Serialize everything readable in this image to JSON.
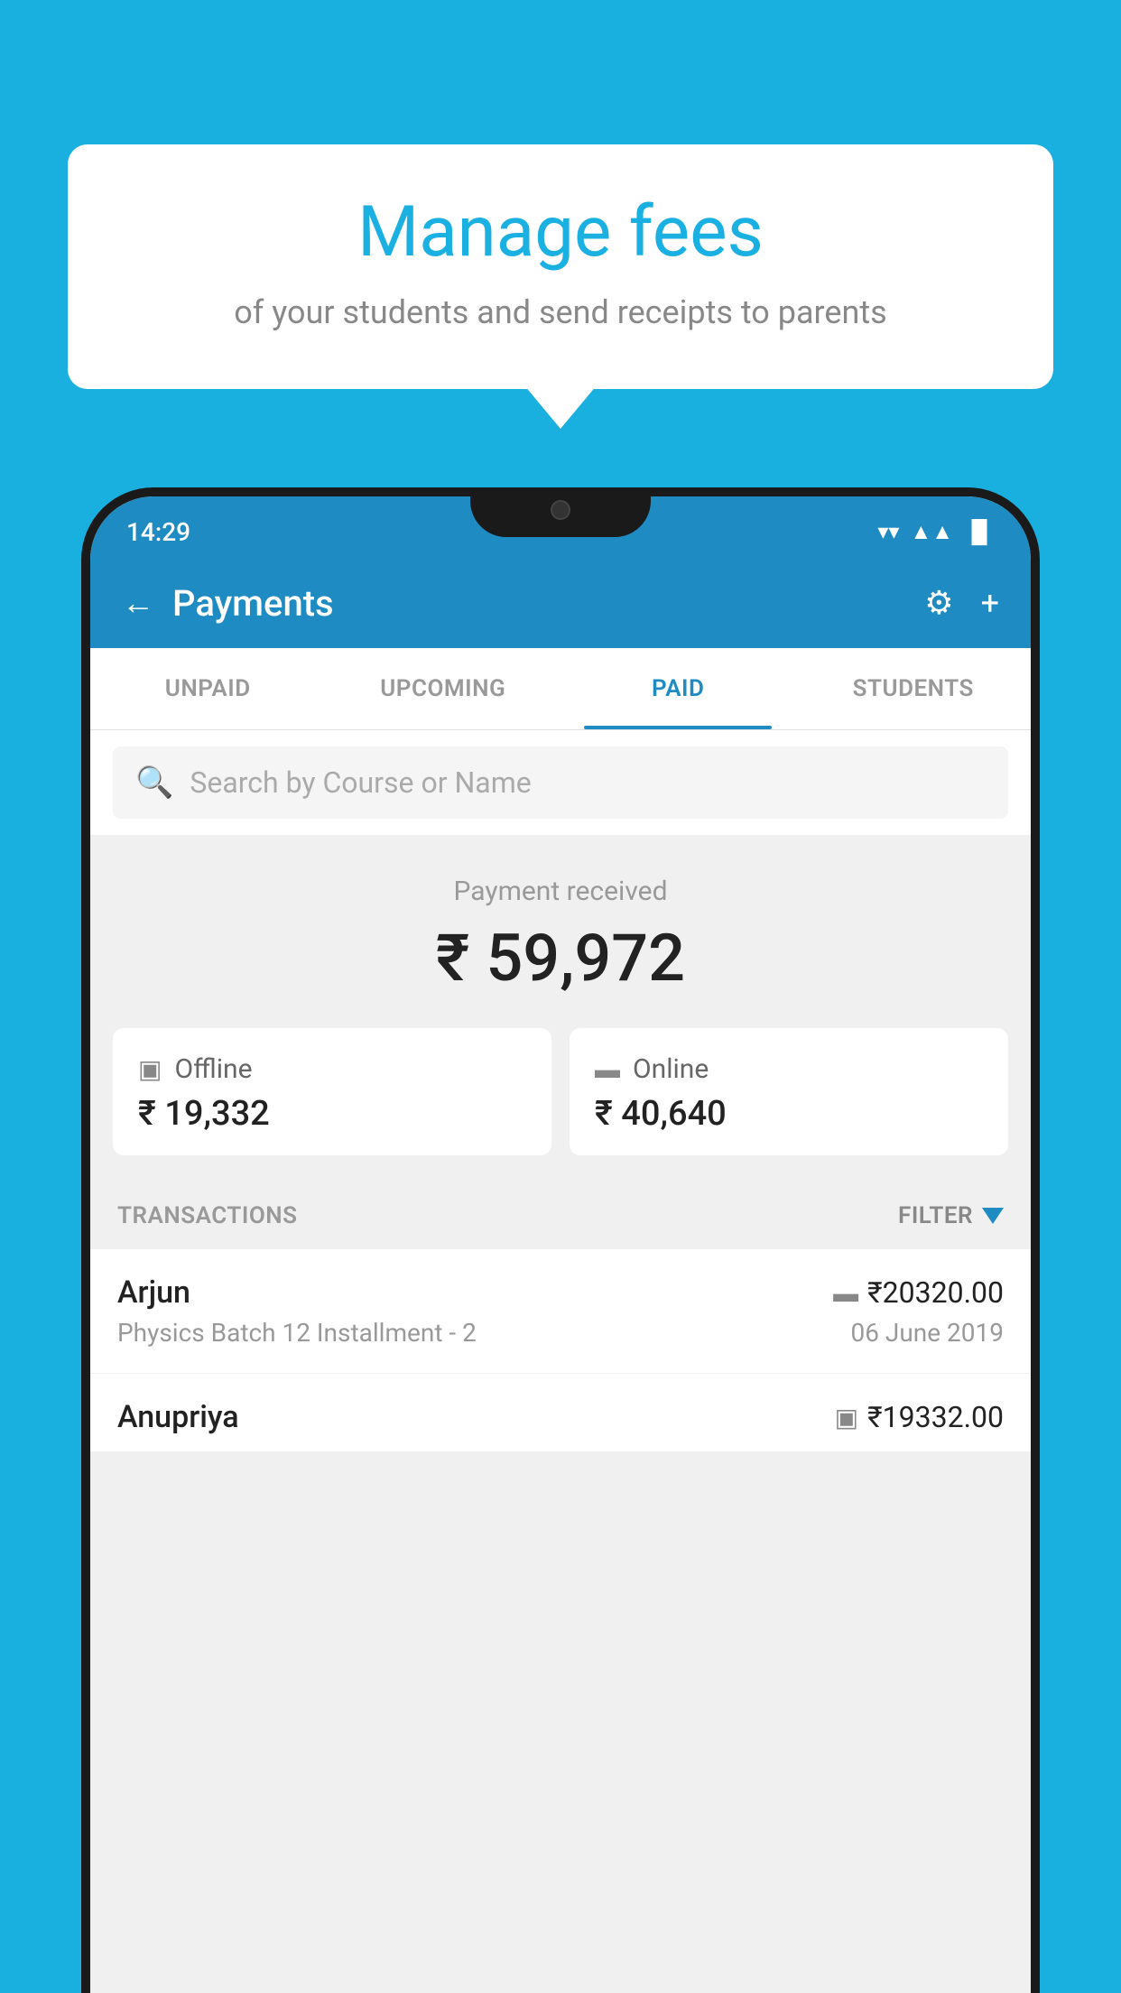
{
  "background_color": "#19b0e0",
  "tooltip": {
    "title": "Manage fees",
    "subtitle": "of your students and send receipts to parents"
  },
  "status_bar": {
    "time": "14:29",
    "wifi_symbol": "▼",
    "signal_symbol": "◀",
    "battery_symbol": "▐"
  },
  "header": {
    "title": "Payments",
    "back_label": "←",
    "gear_label": "⚙",
    "plus_label": "+"
  },
  "tabs": [
    {
      "label": "UNPAID",
      "active": false
    },
    {
      "label": "UPCOMING",
      "active": false
    },
    {
      "label": "PAID",
      "active": true
    },
    {
      "label": "STUDENTS",
      "active": false
    }
  ],
  "search": {
    "placeholder": "Search by Course or Name",
    "icon": "🔍"
  },
  "payment_received": {
    "label": "Payment received",
    "amount": "₹ 59,972"
  },
  "payment_modes": [
    {
      "icon": "▣",
      "label": "Offline",
      "amount": "₹ 19,332"
    },
    {
      "icon": "▬",
      "label": "Online",
      "amount": "₹ 40,640"
    }
  ],
  "transactions": {
    "label": "TRANSACTIONS",
    "filter_label": "FILTER",
    "items": [
      {
        "name": "Arjun",
        "detail": "Physics Batch 12 Installment - 2",
        "amount": "₹20320.00",
        "date": "06 June 2019",
        "mode_icon": "▬"
      },
      {
        "name": "Anupriya",
        "detail": "",
        "amount": "₹19332.00",
        "date": "",
        "mode_icon": "▣"
      }
    ]
  }
}
